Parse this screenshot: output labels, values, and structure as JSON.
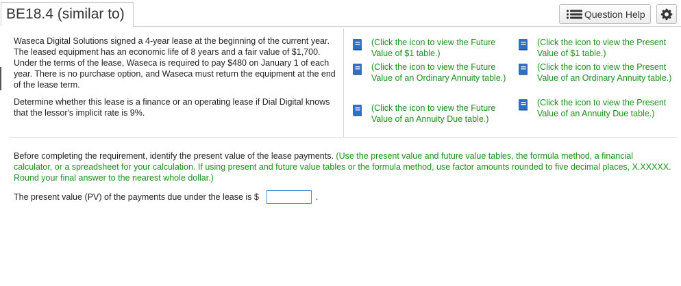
{
  "header": {
    "title": "BE18.4 (similar to)",
    "question_help_label": "Question Help",
    "question_help_icon": "list-icon",
    "settings_icon": "gear-icon"
  },
  "problem": {
    "paragraph1": "Waseca Digital Solutions signed a 4-year lease at the beginning of the current year. The leased equipment has an economic life of 8 years and a fair value of $1,700. Under the terms of the lease, Waseca is required to pay $480 on January 1 of each year. There is no purchase option, and Waseca must return the equipment at the end of the lease term.",
    "paragraph2": "Determine whether this lease is a finance or an operating lease if Dial Digital knows that the lessor's implicit rate is 9%."
  },
  "table_links": [
    {
      "icon": "book-icon",
      "label": "(Click the icon to view the Future Value of $1 table.)"
    },
    {
      "icon": "book-icon",
      "label": "(Click the icon to view the Present Value of $1 table.)"
    },
    {
      "icon": "book-icon",
      "label": "(Click the icon to view the Future Value of an Ordinary Annuity table.)"
    },
    {
      "icon": "book-icon",
      "label": "(Click the icon to view the Present Value of an Ordinary Annuity table.)"
    },
    {
      "icon": "book-icon",
      "label": "(Click the icon to view the Future Value of an Annuity Due table.)"
    },
    {
      "icon": "book-icon",
      "label": "(Click the icon to view the Present Value of an Annuity Due table.)"
    }
  ],
  "requirement": {
    "lead": "Before completing the requirement, identify the present value of the lease payments.",
    "instruction": "(Use the present value and future value tables, the formula method, a financial calculator, or a spreadsheet for your calculation. If using present and future value tables or the formula method, use factor amounts rounded to five decimal places, X.XXXXX. Round your final answer to the nearest whole dollar.)"
  },
  "answer": {
    "prompt": "The present value (PV) of the payments due under the lease is $",
    "value": "",
    "suffix": "."
  },
  "colors": {
    "accent_green": "#1a8f1a",
    "book_blue": "#2f6fc4",
    "input_border": "#4a8fd6"
  }
}
